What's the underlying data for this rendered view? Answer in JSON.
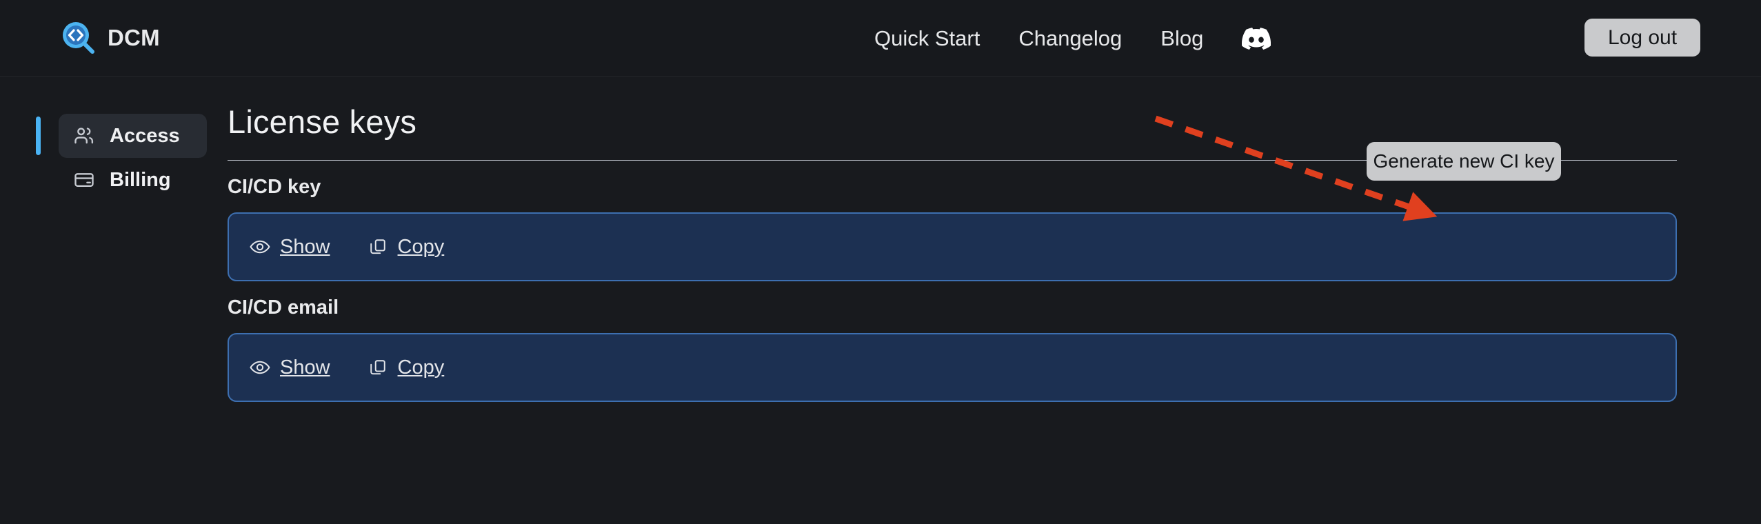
{
  "header": {
    "brand_name": "DCM",
    "brand_logo_icon": "magnifier-code-icon",
    "nav_items": [
      {
        "label": "Quick Start",
        "name": "nav-quick-start"
      },
      {
        "label": "Changelog",
        "name": "nav-changelog"
      },
      {
        "label": "Blog",
        "name": "nav-blog"
      }
    ],
    "discord_icon": "discord-icon",
    "logout_label": "Log out"
  },
  "sidebar": {
    "items": [
      {
        "label": "Access",
        "icon": "users-icon",
        "active": true
      },
      {
        "label": "Billing",
        "icon": "credit-card-icon",
        "active": false
      }
    ]
  },
  "main": {
    "page_title": "License keys",
    "generate_button_label": "Generate new CI key",
    "sections": [
      {
        "label": "CI/CD key",
        "show_label": "Show",
        "copy_label": "Copy",
        "show_icon": "eye-icon",
        "copy_icon": "copy-icon"
      },
      {
        "label": "CI/CD email",
        "show_label": "Show",
        "copy_label": "Copy",
        "show_icon": "eye-icon",
        "copy_icon": "copy-icon"
      }
    ]
  },
  "annotation": {
    "type": "dashed-arrow",
    "color": "#e0401f",
    "points_to": "Generate new CI key"
  },
  "colors": {
    "page_background": "#181a1e",
    "header_background": "#17191d",
    "accent_blue": "#4ab3f4",
    "panel_fill": "#1c3052",
    "panel_border": "#3d6fb0",
    "button_fill": "#c9cacc",
    "annotation_red": "#e0401f"
  }
}
